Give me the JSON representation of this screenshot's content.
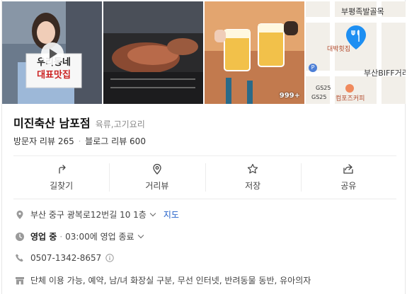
{
  "place": {
    "name": "미진축산 남포점",
    "category": "육류,고기요리",
    "visitor_reviews": "방문자 리뷰 265",
    "blog_reviews": "블로그 리뷰 600"
  },
  "photos": {
    "sign_line1": "우리동네",
    "sign_line2": "대표맛집",
    "photo_count": "999+"
  },
  "map": {
    "street_top": "부평족발골목",
    "shop_label": "대박횟집",
    "area_label": "부산BIFF거리",
    "cafe_label": "컴포즈커피",
    "gas_label": "GS25",
    "gas_label2": "GS25",
    "parking_label": "P"
  },
  "actions": [
    {
      "label": "길찾기",
      "icon": "directions-icon"
    },
    {
      "label": "거리뷰",
      "icon": "street-view-icon"
    },
    {
      "label": "저장",
      "icon": "star-icon"
    },
    {
      "label": "공유",
      "icon": "share-icon"
    }
  ],
  "info": {
    "address": "부산 중구 광복로12번길 10 1층",
    "address_link": "지도",
    "status": "영업 중",
    "hours": "03:00에 영업 종료",
    "phone": "0507-1342-8657",
    "amenities": "단체 이용 가능, 예약, 남/녀 화장실 구분, 무선 인터넷, 반려동물 동반, 유아의자"
  },
  "colors": {
    "link": "#2461c9",
    "map_pin": "#1e8ff2"
  }
}
